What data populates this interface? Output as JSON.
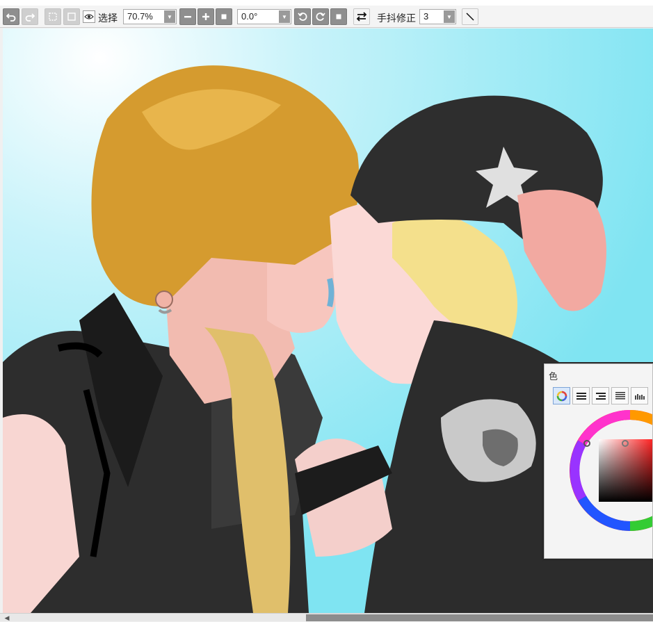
{
  "toolbar": {
    "undo_icon": "undo-icon",
    "redo_icon": "redo-icon",
    "select_label": "选择",
    "zoom_value": "70.7%",
    "zoom_out_icon": "minus-icon",
    "zoom_in_icon": "plus-icon",
    "zoom_reset_icon": "square-icon",
    "rotation_value": "0.0°",
    "rotate_ccw_icon": "rotate-ccw-icon",
    "rotate_cw_icon": "rotate-cw-icon",
    "rotate_reset_icon": "square-icon",
    "flip_icon": "flip-horizontal-icon",
    "stabilizer_label": "手抖修正",
    "stabilizer_value": "3",
    "line_tool_icon": "diagonal-line-icon"
  },
  "color_panel": {
    "title": "色",
    "tabs": [
      "color-wheel-icon",
      "rgb-sliders-icon",
      "hsv-sliders-icon",
      "swatch-list-icon",
      "swatch-grid-icon"
    ],
    "selected_tab": 0,
    "accent_color": "#7a1818"
  },
  "canvas": {
    "background_color": "#9fe8f5"
  }
}
